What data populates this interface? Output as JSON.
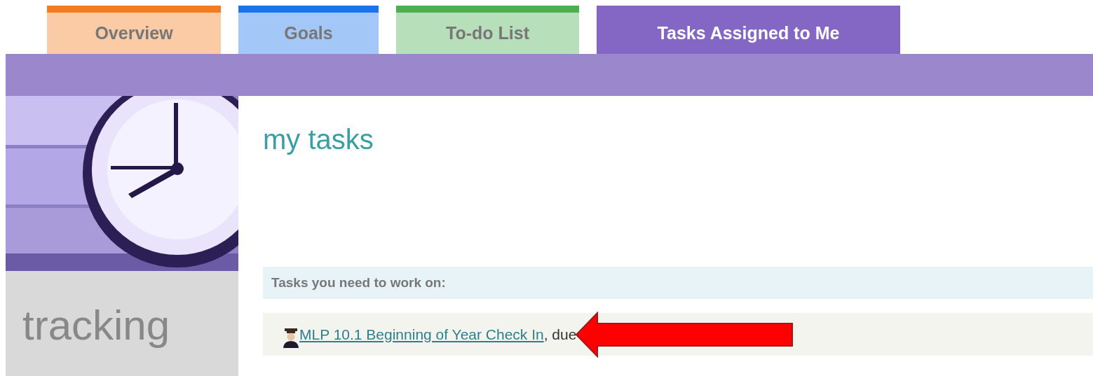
{
  "tabs": [
    {
      "label": "Overview",
      "selected": false,
      "color": "#f47c20"
    },
    {
      "label": "Goals",
      "selected": false,
      "color": "#1a73e8"
    },
    {
      "label": "To-do List",
      "selected": false,
      "color": "#4caf50"
    },
    {
      "label": "Tasks Assigned to Me",
      "selected": true,
      "color": "#8466c4"
    }
  ],
  "sidebar": {
    "title": "tracking"
  },
  "main": {
    "heading": "my tasks",
    "section_title": "Tasks you need to work on:",
    "tasks": [
      {
        "link": "MLP 10.1 Beginning of Year Check In",
        "suffix": ", due"
      }
    ]
  }
}
